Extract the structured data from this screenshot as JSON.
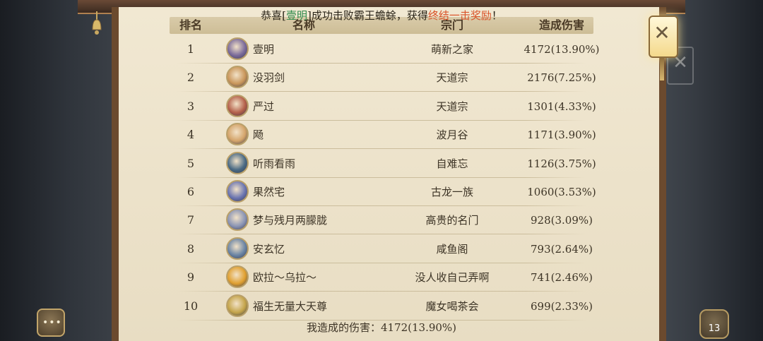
{
  "banner": {
    "prefix": "恭喜[",
    "player": "壹明",
    "middle": "]成功击败霸王蟾蜍，获得",
    "reward": "终结一击奖励",
    "suffix": "！"
  },
  "headers": {
    "rank": "排名",
    "name": "名称",
    "sect": "宗门",
    "damage": "造成伤害"
  },
  "rows": [
    {
      "rank": "1",
      "name": "壹明",
      "sect": "萌新之家",
      "damage": "4172(13.90%)",
      "avatar_color": "#7a6a9a"
    },
    {
      "rank": "2",
      "name": "没羽剑",
      "sect": "天道宗",
      "damage": "2176(7.25%)",
      "avatar_color": "#c9965a"
    },
    {
      "rank": "3",
      "name": "严过",
      "sect": "天道宗",
      "damage": "1301(4.33%)",
      "avatar_color": "#b4604a"
    },
    {
      "rank": "4",
      "name": "飏",
      "sect": "波月谷",
      "damage": "1171(3.90%)",
      "avatar_color": "#d4a46a"
    },
    {
      "rank": "5",
      "name": "听雨看雨",
      "sect": "自难忘",
      "damage": "1126(3.75%)",
      "avatar_color": "#4a6a84"
    },
    {
      "rank": "6",
      "name": "果然宅",
      "sect": "古龙一族",
      "damage": "1060(3.53%)",
      "avatar_color": "#6a74b0"
    },
    {
      "rank": "7",
      "name": "梦与残月两朦胧",
      "sect": "高贵的名门",
      "damage": "928(3.09%)",
      "avatar_color": "#8a94b4"
    },
    {
      "rank": "8",
      "name": "安玄忆",
      "sect": "咸鱼阁",
      "damage": "793(2.64%)",
      "avatar_color": "#6a84a4"
    },
    {
      "rank": "9",
      "name": "欧拉～乌拉～",
      "sect": "没人收自己弄啊",
      "damage": "741(2.46%)",
      "avatar_color": "#e0a030"
    },
    {
      "rank": "10",
      "name": "福生无量大天尊",
      "sect": "魔女喝茶会",
      "damage": "699(2.33%)",
      "avatar_color": "#c4a44a"
    }
  ],
  "my_damage": "我造成的伤害：4172(13.90%)",
  "controls": {
    "close": "✕",
    "chat": "•••",
    "bag_count": "13"
  },
  "colors": {
    "panel_bg": "#ece2cb",
    "frame": "#6b4a2e",
    "highlight_green": "#2d8a4a",
    "highlight_red": "#d9542a"
  }
}
